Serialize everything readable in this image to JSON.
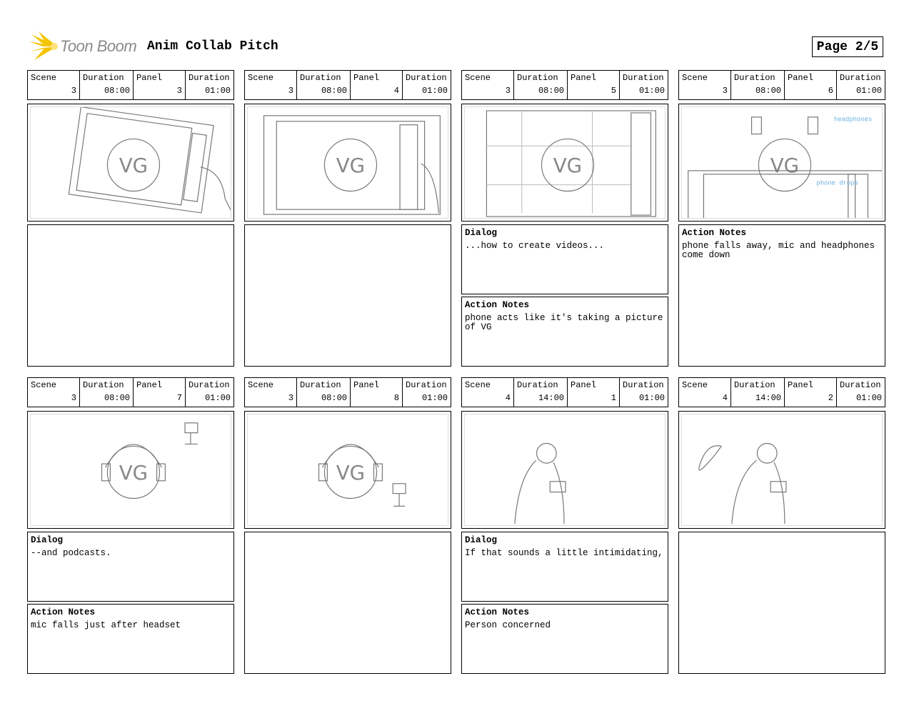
{
  "header": {
    "logo_text": "Toon Boom",
    "title": "Anim Collab Pitch",
    "page": "Page 2/5",
    "logo_color": "#f5c400"
  },
  "labels": {
    "scene": "Scene",
    "duration": "Duration",
    "panel": "Panel",
    "dialog": "Dialog",
    "action": "Action Notes"
  },
  "panels": [
    {
      "scene": "3",
      "scene_duration": "08:00",
      "panel": "3",
      "panel_duration": "01:00",
      "sketch": "phone-tilted-hand",
      "dialog": null,
      "action": null
    },
    {
      "scene": "3",
      "scene_duration": "08:00",
      "panel": "4",
      "panel_duration": "01:00",
      "sketch": "phone-hand",
      "dialog": null,
      "action": null
    },
    {
      "scene": "3",
      "scene_duration": "08:00",
      "panel": "5",
      "panel_duration": "01:00",
      "sketch": "phone-screen-grid",
      "dialog": "...how to create videos...",
      "action": "phone acts like it's taking a picture of VG"
    },
    {
      "scene": "3",
      "scene_duration": "08:00",
      "panel": "6",
      "panel_duration": "01:00",
      "sketch": "phone-falls-headphones",
      "dialog": null,
      "action": "phone falls away, mic and headphones come down"
    },
    {
      "scene": "3",
      "scene_duration": "08:00",
      "panel": "7",
      "panel_duration": "01:00",
      "sketch": "headphones-mic-top",
      "dialog": "--and podcasts.",
      "action": "mic falls just after headset"
    },
    {
      "scene": "3",
      "scene_duration": "08:00",
      "panel": "8",
      "panel_duration": "01:00",
      "sketch": "headphones-mic-bottom",
      "dialog": null,
      "action": null
    },
    {
      "scene": "4",
      "scene_duration": "14:00",
      "panel": "1",
      "panel_duration": "01:00",
      "sketch": "person-phone",
      "dialog": "If that sounds a little intimidating,",
      "action": "Person concerned"
    },
    {
      "scene": "4",
      "scene_duration": "14:00",
      "panel": "2",
      "panel_duration": "01:00",
      "sketch": "person-butterfly",
      "dialog": null,
      "action": null
    }
  ]
}
